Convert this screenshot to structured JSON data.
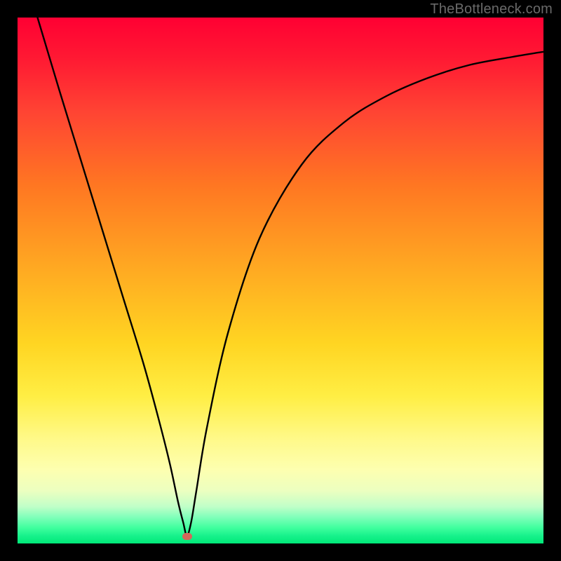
{
  "watermark": "TheBottleneck.com",
  "chart_data": {
    "type": "line",
    "title": "",
    "xlabel": "",
    "ylabel": "",
    "xlim": [
      0,
      100
    ],
    "ylim": [
      0,
      100
    ],
    "series": [
      {
        "name": "bottleneck-curve",
        "x": [
          2,
          5,
          8,
          12,
          16,
          20,
          24,
          27,
          29,
          30.5,
          31.5,
          32.2,
          33,
          34,
          36,
          40,
          46,
          54,
          62,
          70,
          78,
          86,
          94,
          100
        ],
        "y": [
          106,
          96,
          86,
          73,
          60,
          47,
          34,
          23,
          15,
          8,
          4,
          1.5,
          4,
          10,
          22,
          40,
          58,
          72,
          80,
          85,
          88.5,
          91,
          92.5,
          93.5
        ]
      }
    ],
    "marker": {
      "x": 32.2,
      "y": 1.4,
      "color": "#d4665a"
    },
    "gradient_stops": [
      {
        "pos": 0,
        "color": "#ff0033"
      },
      {
        "pos": 50,
        "color": "#ffcc22"
      },
      {
        "pos": 85,
        "color": "#fdff99"
      },
      {
        "pos": 100,
        "color": "#00e878"
      }
    ]
  }
}
